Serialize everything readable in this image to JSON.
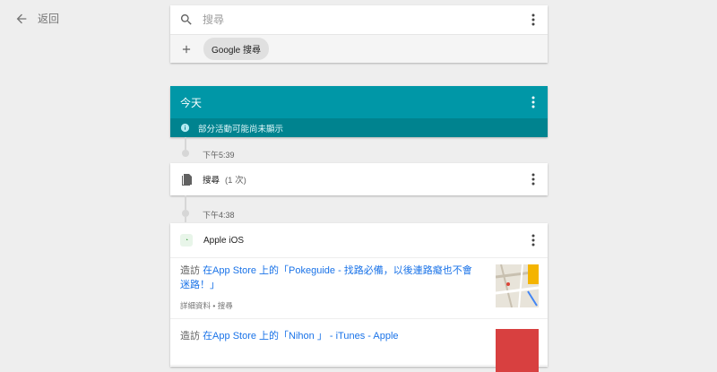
{
  "nav": {
    "back_label": "返回"
  },
  "search": {
    "placeholder": "搜尋",
    "chips": [
      {
        "label": "Google 搜尋"
      }
    ]
  },
  "today": {
    "title": "今天",
    "notice": "部分活動可能尚未顯示"
  },
  "timeline": [
    {
      "time": "下午5:39",
      "item": {
        "label": "搜尋",
        "count": "(1 次)"
      }
    },
    {
      "time": "下午4:38",
      "item": {
        "app": "Apple iOS",
        "visits": [
          {
            "verb": "造訪",
            "link": "在App Store 上的「Pokeguide - 找路必備，以後連路癡也不會迷路！」",
            "meta": "詳細資料 • 搜尋"
          },
          {
            "verb": "造訪",
            "link": "在App Store 上的「Nihon 」 - iTunes - Apple"
          }
        ]
      }
    }
  ],
  "colors": {
    "accent": "#0097a7",
    "accent_dark": "#00838f",
    "link": "#1a73e8",
    "thumb2": "#d84040"
  }
}
